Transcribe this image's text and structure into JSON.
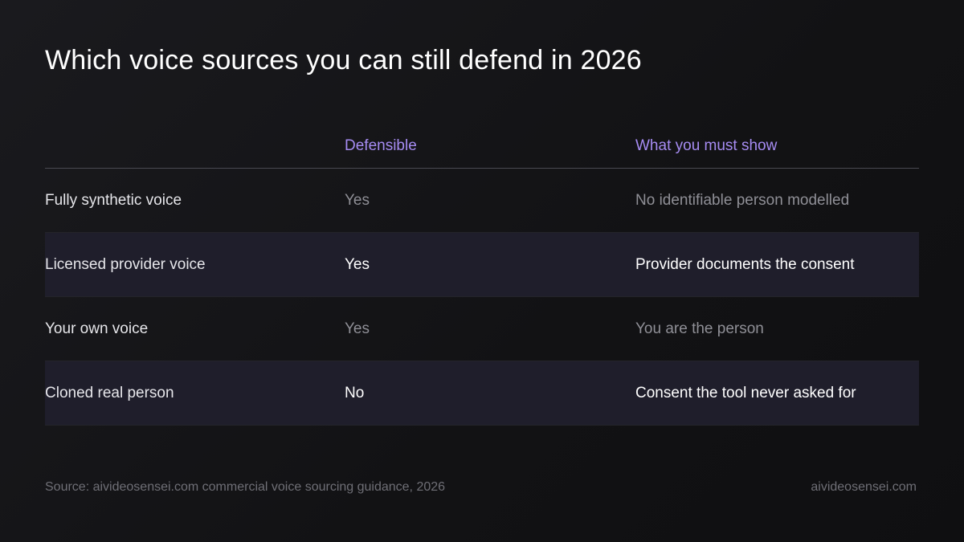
{
  "title": "Which voice sources you can still defend in 2026",
  "table": {
    "headers": [
      "",
      "Defensible",
      "What you must show"
    ],
    "rows": [
      {
        "source": "Fully synthetic voice",
        "defensible": "Yes",
        "must_show": "No identifiable person modelled",
        "highlighted": false
      },
      {
        "source": "Licensed provider voice",
        "defensible": "Yes",
        "must_show": "Provider documents the consent",
        "highlighted": true
      },
      {
        "source": "Your own voice",
        "defensible": "Yes",
        "must_show": "You are the person",
        "highlighted": false
      },
      {
        "source": "Cloned real person",
        "defensible": "No",
        "must_show": "Consent the tool never asked for",
        "highlighted": true
      }
    ]
  },
  "footer": {
    "source": "Source: aivideosensei.com commercial voice sourcing guidance, 2026",
    "brand": "aivideosensei.com"
  },
  "colors": {
    "background": "#141416",
    "header_accent": "#a68cf2",
    "highlight_row": "#1f1e2b",
    "muted_text": "#8f8f96"
  }
}
